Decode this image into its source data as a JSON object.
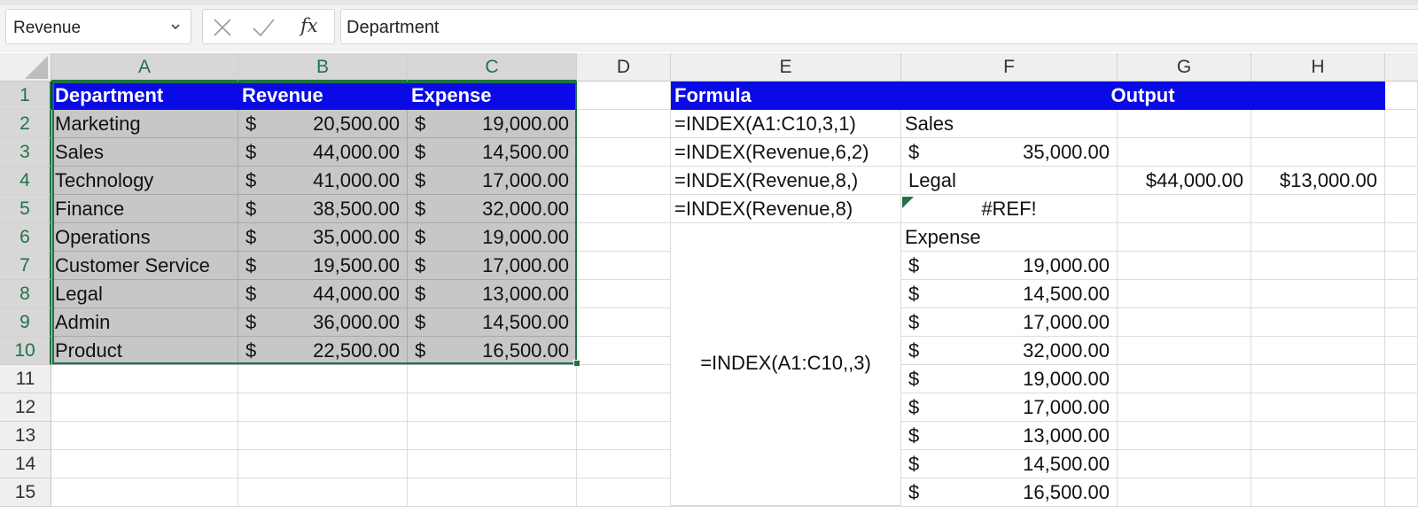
{
  "name_box": "Revenue",
  "formula_bar": {
    "fx_label": "fx",
    "content": "Department"
  },
  "columns": [
    "A",
    "B",
    "C",
    "D",
    "E",
    "F",
    "G",
    "H"
  ],
  "rows": [
    "1",
    "2",
    "3",
    "4",
    "5",
    "6",
    "7",
    "8",
    "9",
    "10",
    "11",
    "12",
    "13",
    "14",
    "15"
  ],
  "table": {
    "headers": [
      "Department",
      "Revenue",
      "Expense"
    ],
    "rows": [
      {
        "dept": "Marketing",
        "cur_b": "$",
        "revenue": "20,500.00",
        "cur_c": "$",
        "expense": "19,000.00"
      },
      {
        "dept": "Sales",
        "cur_b": "$",
        "revenue": "44,000.00",
        "cur_c": "$",
        "expense": "14,500.00"
      },
      {
        "dept": "Technology",
        "cur_b": "$",
        "revenue": "41,000.00",
        "cur_c": "$",
        "expense": "17,000.00"
      },
      {
        "dept": "Finance",
        "cur_b": "$",
        "revenue": "38,500.00",
        "cur_c": "$",
        "expense": "32,000.00"
      },
      {
        "dept": "Operations",
        "cur_b": "$",
        "revenue": "35,000.00",
        "cur_c": "$",
        "expense": "19,000.00"
      },
      {
        "dept": "Customer Service",
        "cur_b": "$",
        "revenue": "19,500.00",
        "cur_c": "$",
        "expense": "17,000.00"
      },
      {
        "dept": "Legal",
        "cur_b": "$",
        "revenue": "44,000.00",
        "cur_c": "$",
        "expense": "13,000.00"
      },
      {
        "dept": "Admin",
        "cur_b": "$",
        "revenue": "36,000.00",
        "cur_c": "$",
        "expense": "14,500.00"
      },
      {
        "dept": "Product",
        "cur_b": "$",
        "revenue": "22,500.00",
        "cur_c": "$",
        "expense": "16,500.00"
      }
    ]
  },
  "examples": {
    "formula_header": "Formula",
    "output_header": "Output",
    "f1": "=INDEX(A1:C10,3,1)",
    "o1": "Sales",
    "f2": "=INDEX(Revenue,6,2)",
    "o2_cur": "$",
    "o2": "35,000.00",
    "f3": "=INDEX(Revenue,8,)",
    "o3_f": "Legal",
    "o3_g": "$44,000.00",
    "o3_h": "$13,000.00",
    "f4": "=INDEX(Revenue,8)",
    "o4": "#REF!",
    "f5": "=INDEX(A1:C10,,3)",
    "o5_header": "Expense",
    "o5_cur": "$",
    "o5_values": [
      "19,000.00",
      "14,500.00",
      "17,000.00",
      "32,000.00",
      "19,000.00",
      "17,000.00",
      "13,000.00",
      "14,500.00",
      "16,500.00"
    ]
  },
  "colors": {
    "header_fill": "#0a0ae6",
    "selection": "#217346",
    "table_fill": "#c7c7c7"
  }
}
